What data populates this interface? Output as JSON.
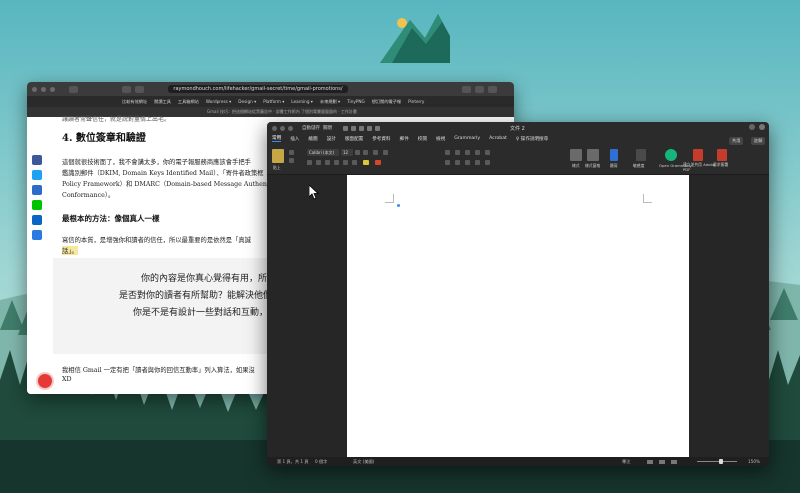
{
  "browser": {
    "url": "raymondhouch.com/lifehacker/gmail-secret/time/gmail-promotions/",
    "bookmarks": [
      "比較有效網址",
      "閱讀工具",
      "工具箱網站",
      "Wordpress ▾",
      "Design ▾",
      "Platform ▾",
      "Learning ▾",
      "未來規劃 ▾",
      "TinyPNG",
      "想訂閱的電子報",
      "Pinterry"
    ],
    "tab_text": "Gmail 技巧：把這個網站從黑廣告中 · 部書工作術內 了個別電書量量量的 · 工作計畫",
    "page": {
      "top_line": "讓讀者常聲信任，就是說對量情上出毛。",
      "heading": "4. 數位簽章和驗證",
      "para1_line1": "這個就很技術面了，我不會講太多，你的電子報服務商應該會手把手",
      "para1_line2": "鑑識別郵件（DKIM, Domain Keys Identified Mail）、「寄件者政策框",
      "para1_line3": "Policy Framework）和 DMARC（Domain-based Message Authentica",
      "para1_line4": "Conformance）。",
      "subheading": "最根本的方法：像個真人一樣",
      "para2_line1": "寫信的本質，是增強你和讀者的信任，所以最重要的是依然是「真誠",
      "para2_line2": "話」。",
      "quote_line1": "你的內容是你真心覺得有用，所以才分",
      "quote_line2": "是否對你的讀者有所幫助？能解決他們的難",
      "quote_line3": "你是不是有設計一些對話和互動，鼓勵他",
      "para3_line1": "我相信 Gmail 一定有把「讀者與你的回信互動率」列入算法，如果沒",
      "para3_line2": "XD"
    }
  },
  "word": {
    "title": "文件 2",
    "quick_access_label": "自動儲存",
    "quick_access_state": "關閉",
    "tabs": [
      "常用",
      "插入",
      "繪圖",
      "設計",
      "版面配置",
      "參考資料",
      "郵件",
      "校閱",
      "檢視",
      "Grammarly",
      "Acrobat",
      "♀ 操作說明搜尋"
    ],
    "active_tab": "常用",
    "share_label": "共用",
    "comment_label": "註解",
    "font_name": "Calibri (本文)",
    "font_size": "12",
    "ribbon_labels": {
      "paste": "貼上",
      "styles": "樣式",
      "styles_pane": "樣式窗格",
      "dictate": "聽寫",
      "sensitivity": "敏感度",
      "open_grammarly": "Open Grammarly",
      "create_pdf": "建立並共用 Adobe PDF",
      "request_sign": "要求簽署"
    },
    "status": {
      "page": "第 1 頁，共 1 頁",
      "words": "0 個字",
      "language": "英文 (美國)",
      "focus": "專注",
      "zoom": "150%"
    }
  }
}
